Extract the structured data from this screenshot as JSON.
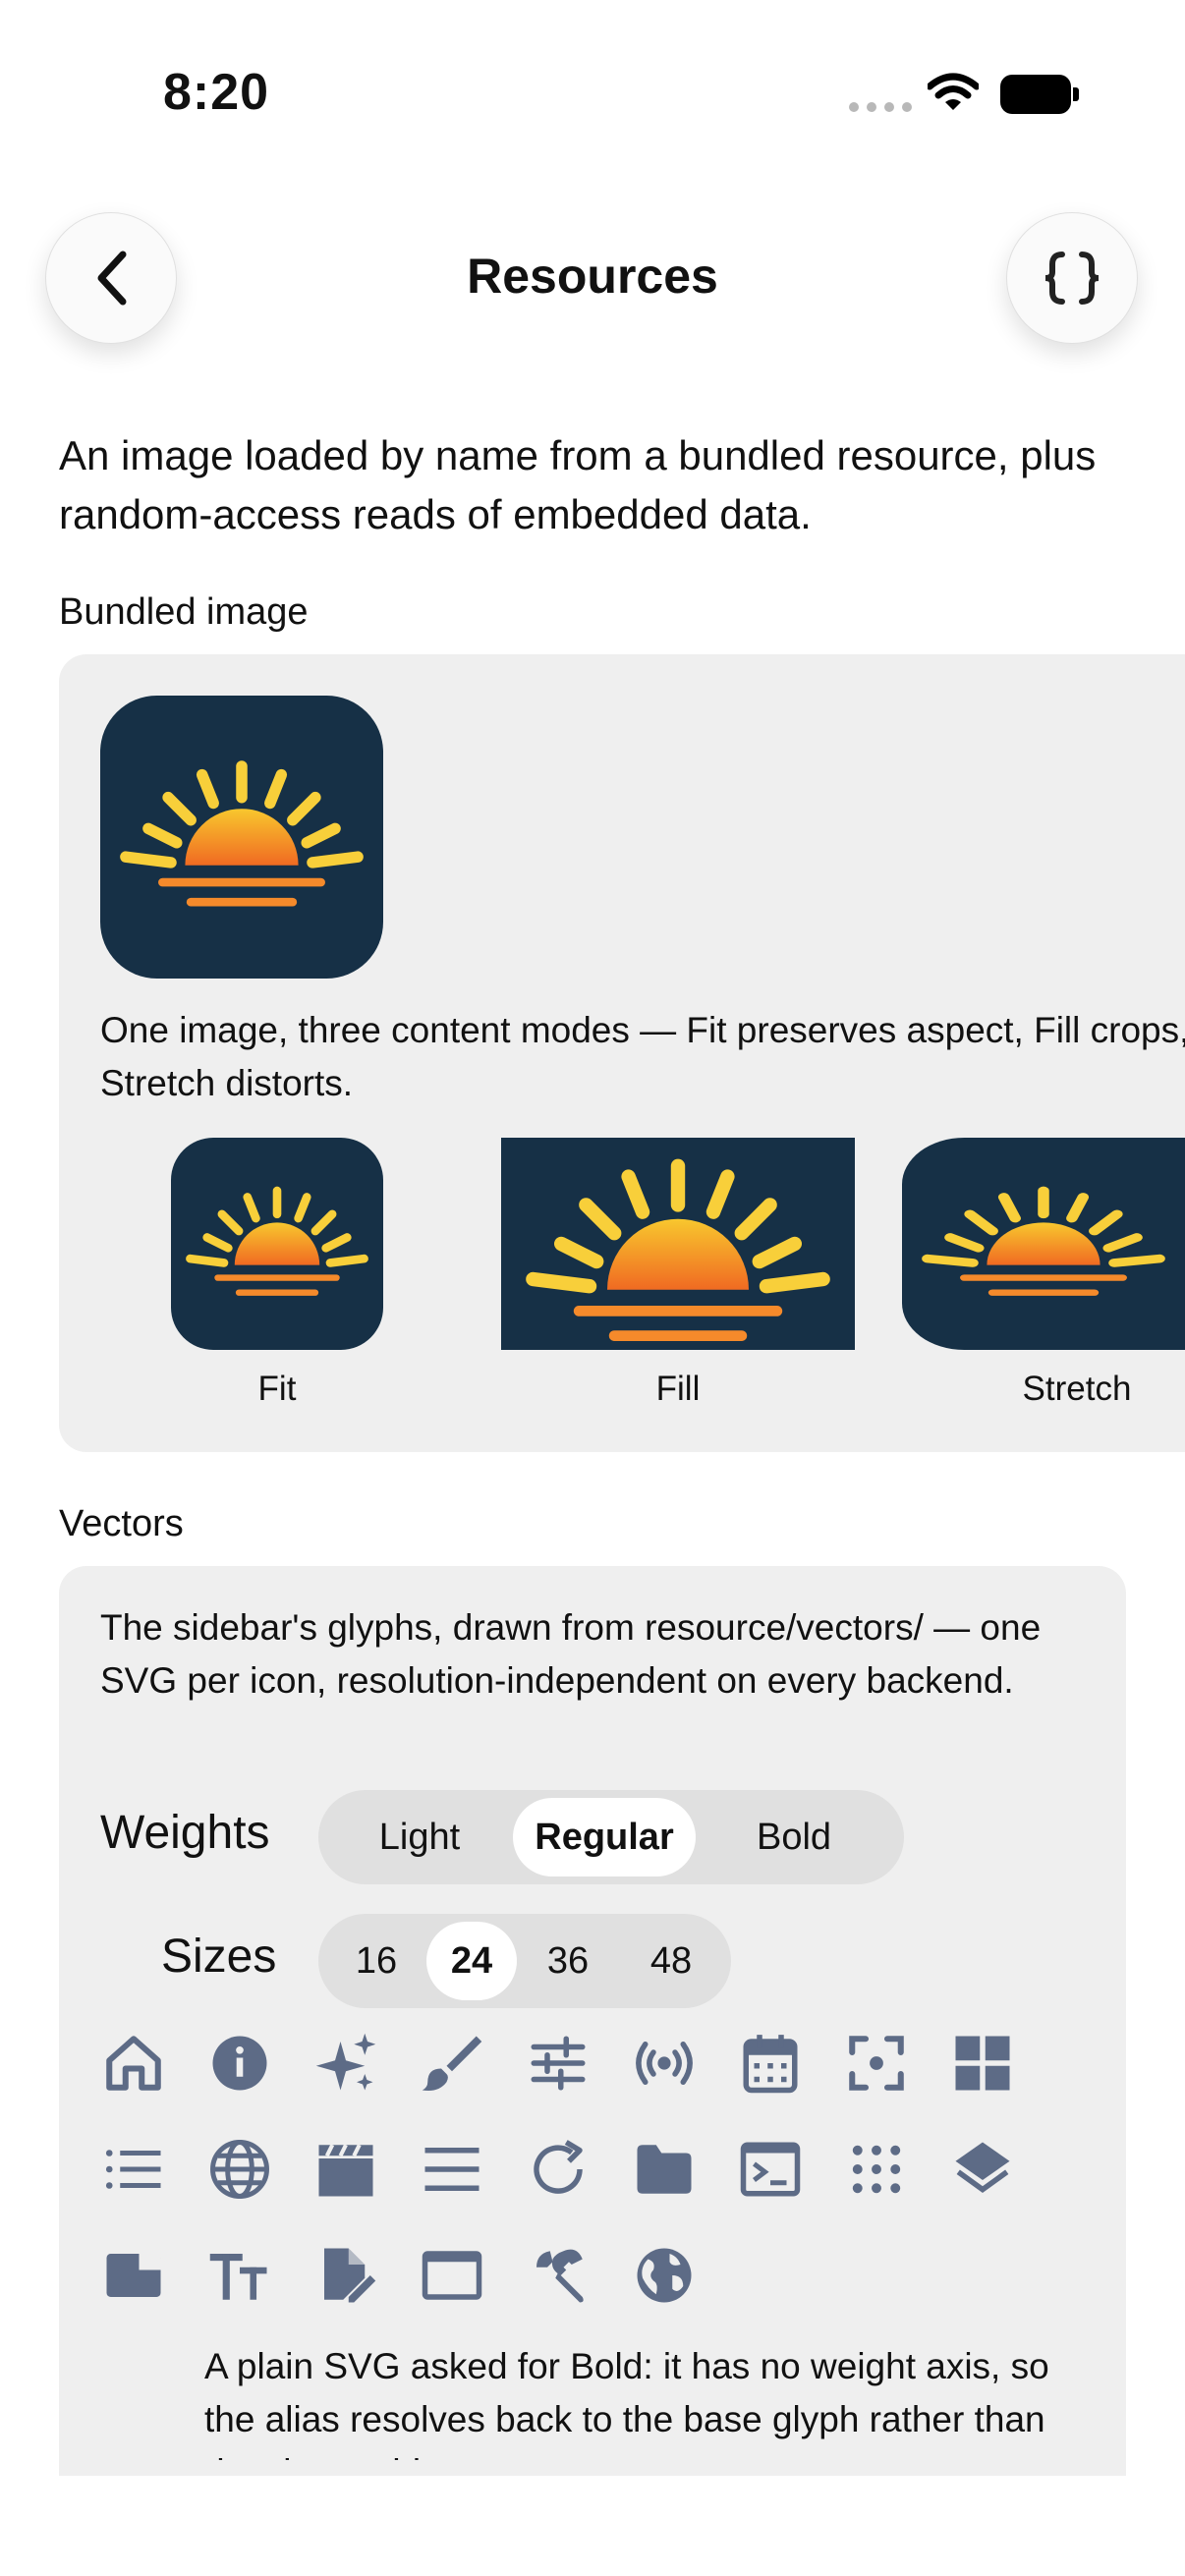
{
  "status": {
    "time": "8:20"
  },
  "nav": {
    "title": "Resources"
  },
  "intro": "An image loaded by name from a bundled resource, plus random-access reads of embedded data.",
  "bundled": {
    "label": "Bundled image",
    "caption": "One image, three content modes — Fit preserves aspect, Fill crops, Stretch distorts.",
    "modes": [
      "Fit",
      "Fill",
      "Stretch"
    ]
  },
  "vectors": {
    "label": "Vectors",
    "description": "The sidebar's glyphs, drawn from resource/vectors/ — one SVG per icon, resolution-independent on every backend.",
    "weights_label": "Weights",
    "weights": [
      "Light",
      "Regular",
      "Bold"
    ],
    "weights_selected": "Regular",
    "sizes_label": "Sizes",
    "sizes": [
      "16",
      "24",
      "36",
      "48"
    ],
    "sizes_selected": "24",
    "icons": [
      "home-icon",
      "info-icon",
      "sparkles-icon",
      "brush-icon",
      "sliders-icon",
      "broadcast-icon",
      "calendar-icon",
      "focus-icon",
      "grid-icon",
      "list-icon",
      "globe-icon",
      "clapperboard-icon",
      "menu-icon",
      "refresh-icon",
      "folder-icon",
      "terminal-icon",
      "dots-grid-icon",
      "layers-icon",
      "sidebar-panel-icon",
      "text-size-icon",
      "document-edit-icon",
      "window-icon",
      "wrench-icon",
      "earth-icon"
    ],
    "footnote": "A plain SVG asked for Bold: it has no weight axis, so the alias resolves back to the base glyph rather than drawing nothing."
  },
  "colors": {
    "icon": "#5d6b86",
    "image_bg": "#163046",
    "sun_top": "#f8c72e",
    "sun_bottom": "#f06a22",
    "rays": "#f8cf3a"
  }
}
